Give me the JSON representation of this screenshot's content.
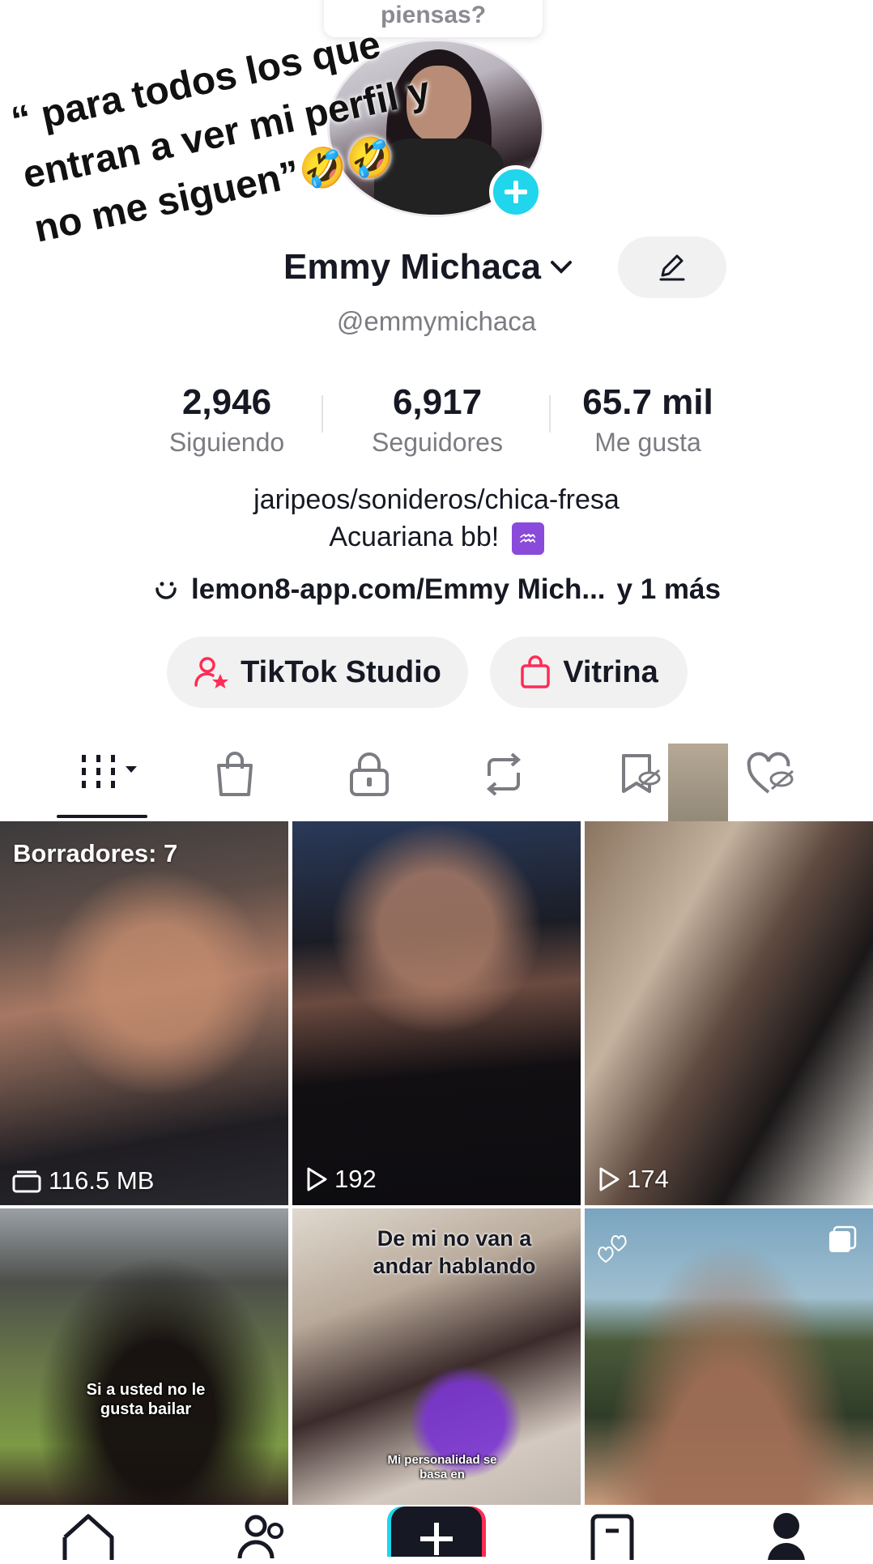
{
  "top_bubble": {
    "text": "piensas?"
  },
  "overlay": {
    "lines": [
      "“ para todos los que",
      "entran a ver mi perfil y",
      "no me siguen”🤣🤣"
    ]
  },
  "profile": {
    "display_name": "Emmy Michaca",
    "handle": "@emmymichaca",
    "stats": [
      {
        "value": "2,946",
        "label": "Siguiendo"
      },
      {
        "value": "6,917",
        "label": "Seguidores"
      },
      {
        "value": "65.7 mil",
        "label": "Me gusta"
      }
    ],
    "bio_line1": "jaripeos/sonideros/chica-fresa",
    "bio_line2": "Acuariana bb!",
    "bio_emoji": "♒",
    "link_text": "lemon8-app.com/Emmy Mich...",
    "link_more": "y 1 más"
  },
  "buttons": {
    "studio": "TikTok Studio",
    "showcase": "Vitrina"
  },
  "grid": {
    "drafts_label": "Borradores: 7",
    "drafts_size": "116.5 MB",
    "views": [
      "192",
      "174"
    ],
    "meme1": "Si a usted no le gusta bailar",
    "meme2_top": "De mi no van a andar hablando",
    "meme2_bottom": "Mi personalidad se basa en"
  },
  "colors": {
    "accent_teal": "#20d5ec",
    "accent_pink": "#fe2c55",
    "text_primary": "#161823",
    "text_secondary": "#7b7c82"
  }
}
